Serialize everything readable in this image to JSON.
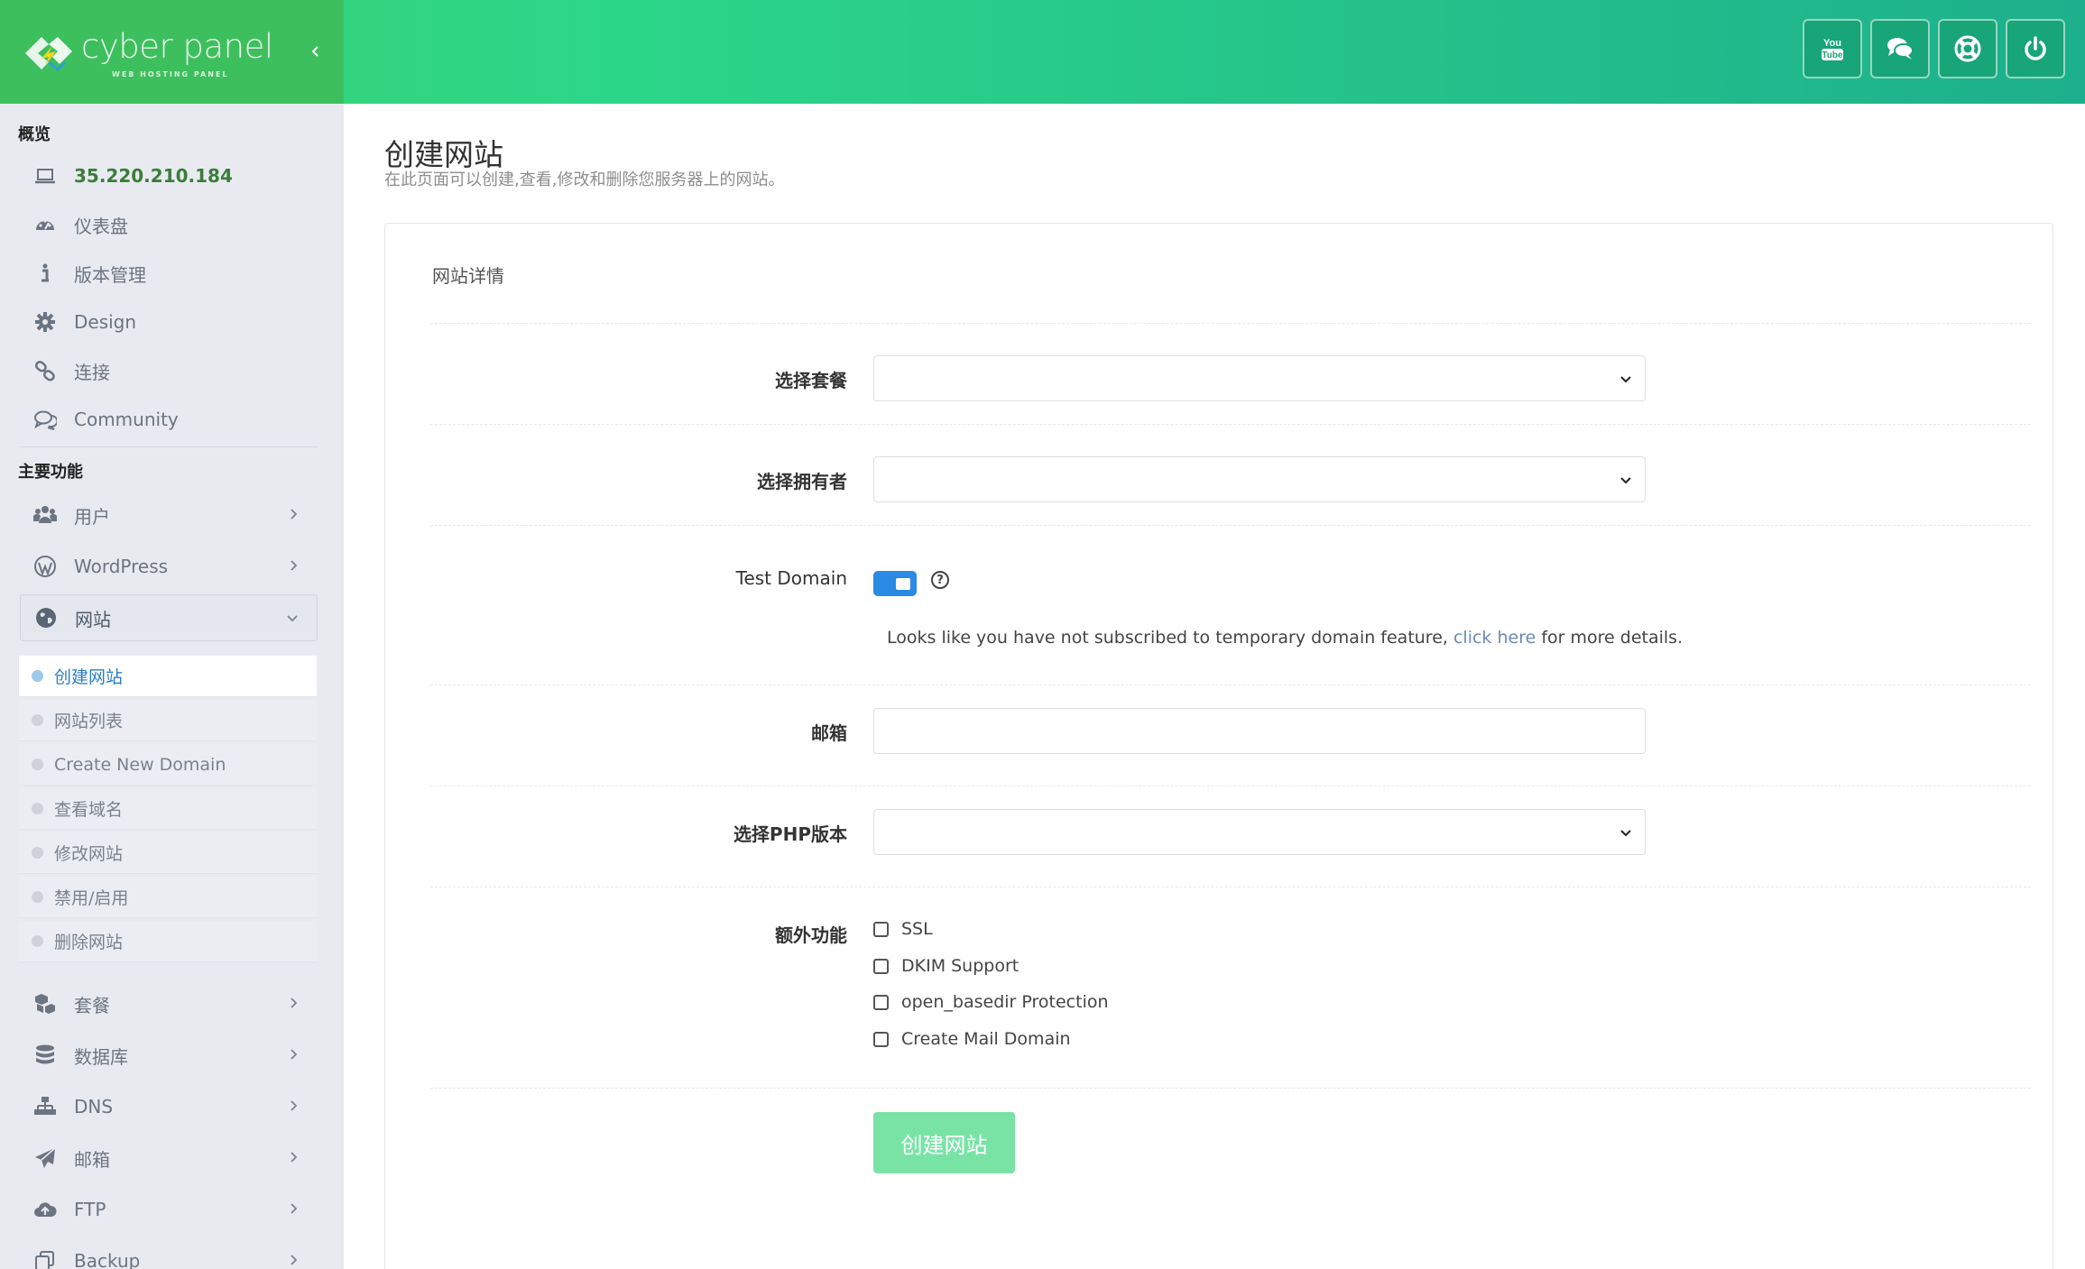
{
  "topbar": {
    "logo": {
      "text": "cyber panel",
      "subtitle": "WEB HOSTING PANEL"
    },
    "collapse_icon": "chevron-left-icon",
    "actions": [
      {
        "name": "youtube-button",
        "icon": "youtube-icon"
      },
      {
        "name": "chat-button",
        "icon": "chat-icon"
      },
      {
        "name": "support-button",
        "icon": "lifebuoy-icon"
      },
      {
        "name": "power-button",
        "icon": "power-icon"
      }
    ]
  },
  "sidebar": {
    "sections": {
      "overview": "概览",
      "main_features": "主要功能"
    },
    "overview_items": [
      {
        "label": "35.220.210.184",
        "icon": "laptop-icon"
      },
      {
        "label": "仪表盘",
        "icon": "dashboard-icon"
      },
      {
        "label": "版本管理",
        "icon": "info-icon"
      },
      {
        "label": "Design",
        "icon": "gear-icon"
      },
      {
        "label": "连接",
        "icon": "link-icon"
      },
      {
        "label": "Community",
        "icon": "chat-icon"
      }
    ],
    "main_items": [
      {
        "label": "用户",
        "icon": "users-icon"
      },
      {
        "label": "WordPress",
        "icon": "wordpress-icon"
      },
      {
        "label": "网站",
        "icon": "globe-icon",
        "expanded": true
      }
    ],
    "websites_sub": [
      {
        "label": "创建网站",
        "active": true
      },
      {
        "label": "网站列表"
      },
      {
        "label": "Create New Domain"
      },
      {
        "label": "查看域名"
      },
      {
        "label": "修改网站"
      },
      {
        "label": "禁用/启用"
      },
      {
        "label": "删除网站"
      }
    ],
    "more_items": [
      {
        "label": "套餐",
        "icon": "cubes-icon"
      },
      {
        "label": "数据库",
        "icon": "database-icon"
      },
      {
        "label": "DNS",
        "icon": "sitemap-icon"
      },
      {
        "label": "邮箱",
        "icon": "paper-plane-icon"
      },
      {
        "label": "FTP",
        "icon": "cloud-upload-icon"
      },
      {
        "label": "Backup",
        "icon": "copy-icon"
      }
    ]
  },
  "main": {
    "title": "创建网站",
    "description": "在此页面可以创建,查看,修改和删除您服务器上的网站。",
    "panel_title": "网站详情",
    "fields": {
      "package": {
        "label": "选择套餐",
        "value": ""
      },
      "owner": {
        "label": "选择拥有者",
        "value": ""
      },
      "test_domain": {
        "label": "Test Domain",
        "enabled": true,
        "note_before": "Looks like you have not subscribed to temporary domain feature,",
        "note_link": "click here",
        "note_after": "for more details."
      },
      "email": {
        "label": "邮箱",
        "value": ""
      },
      "php": {
        "label": "选择PHP版本",
        "value": ""
      },
      "extras": {
        "label": "额外功能",
        "options": [
          {
            "label": "SSL",
            "checked": false
          },
          {
            "label": "DKIM Support",
            "checked": false
          },
          {
            "label": "open_basedir Protection",
            "checked": false
          },
          {
            "label": "Create Mail Domain",
            "checked": false
          }
        ]
      }
    },
    "submit_label": "创建网站"
  },
  "colors": {
    "topbar_gradient": [
      "#3bd274",
      "#1db08c"
    ],
    "logo_bg": "#3dbf5e",
    "sidebar_bg": "#e8eaf0",
    "accent_blue": "#2a7ec7",
    "toggle_on": "#2b8ae3",
    "button_disabled": "#79e3a6",
    "ip_green": "#3b7d3b"
  }
}
